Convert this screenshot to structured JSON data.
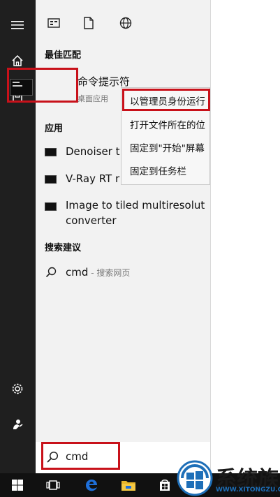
{
  "sections": {
    "best_match": "最佳匹配",
    "apps": "应用",
    "suggestions": "搜索建议"
  },
  "best_match": {
    "title": "命令提示符",
    "subtitle": "桌面应用"
  },
  "apps": [
    {
      "label": "Denoiser t"
    },
    {
      "label": "V-Ray RT r"
    },
    {
      "label": "Image to tiled multiresolut",
      "label2": "converter"
    }
  ],
  "suggestion": {
    "query": "cmd",
    "suffix": " - 搜索网页"
  },
  "context_menu": [
    {
      "label": "以管理员身份运行"
    },
    {
      "label": "打开文件所在的位"
    },
    {
      "label": "固定到\"开始\"屏幕"
    },
    {
      "label": "固定到任务栏"
    }
  ],
  "search": {
    "value": "cmd"
  },
  "watermark": {
    "brand": "系统族",
    "url": "WWW.XITONGZU.COM"
  },
  "colors": {
    "highlight": "#c8111a",
    "rail": "#1f1f1f",
    "taskbar": "#111111",
    "edge_blue": "#1e6fd9"
  },
  "icons": {
    "rail": [
      "hamburger-icon",
      "home-icon",
      "documents-icon",
      "settings-icon",
      "user-icon"
    ],
    "top": [
      "apps-filter-icon",
      "document-filter-icon",
      "web-filter-icon"
    ],
    "taskbar": [
      "windows-start-icon",
      "task-view-icon",
      "edge-icon",
      "file-explorer-icon",
      "store-icon"
    ]
  }
}
